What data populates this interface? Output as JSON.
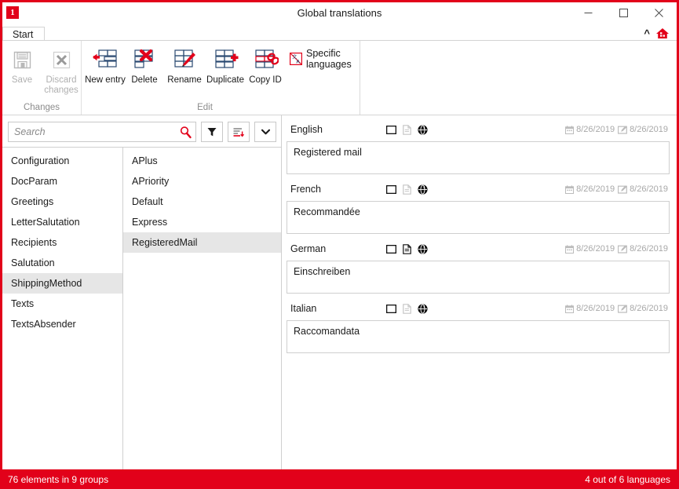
{
  "window": {
    "title": "Global translations",
    "app_icon": "1",
    "controls": {
      "minimize": "minimize-icon",
      "maximize": "maximize-icon",
      "close": "close-icon",
      "collapse_ribbon": "chevron-up-icon",
      "help": "home-icon"
    }
  },
  "ribbon": {
    "tabs": [
      {
        "label": "Start",
        "active": true
      }
    ],
    "groups": [
      {
        "label": "Changes",
        "buttons": [
          {
            "label": "Save",
            "icon": "save-icon",
            "enabled": false
          },
          {
            "label": "Discard changes",
            "icon": "discard-icon",
            "enabled": false
          }
        ]
      },
      {
        "label": "Edit",
        "buttons": [
          {
            "label": "New entry",
            "icon": "new-entry-icon",
            "enabled": true
          },
          {
            "label": "Delete",
            "icon": "delete-icon",
            "enabled": true
          },
          {
            "label": "Rename",
            "icon": "rename-icon",
            "enabled": true
          },
          {
            "label": "Duplicate",
            "icon": "duplicate-icon",
            "enabled": true
          },
          {
            "label": "Copy ID",
            "icon": "copy-id-icon",
            "enabled": true
          }
        ],
        "inline_buttons": [
          {
            "label": "Specific languages",
            "icon": "specific-languages-icon",
            "enabled": true
          }
        ]
      }
    ]
  },
  "search": {
    "value": "",
    "placeholder": "Search",
    "icon": "search-icon",
    "buttons": [
      {
        "name": "filter-button",
        "icon": "funnel-icon"
      },
      {
        "name": "sort-button",
        "icon": "sort-descending-icon"
      },
      {
        "name": "more-options-button",
        "icon": "chevron-down-icon"
      }
    ]
  },
  "groups_list": {
    "items": [
      {
        "label": "Configuration",
        "selected": false
      },
      {
        "label": "DocParam",
        "selected": false
      },
      {
        "label": "Greetings",
        "selected": false
      },
      {
        "label": "LetterSalutation",
        "selected": false
      },
      {
        "label": "Recipients",
        "selected": false
      },
      {
        "label": "Salutation",
        "selected": false
      },
      {
        "label": "ShippingMethod",
        "selected": true
      },
      {
        "label": "Texts",
        "selected": false
      },
      {
        "label": "TextsAbsender",
        "selected": false
      }
    ]
  },
  "entries_list": {
    "items": [
      {
        "label": "APlus",
        "selected": false
      },
      {
        "label": "APriority",
        "selected": false
      },
      {
        "label": "Default",
        "selected": false
      },
      {
        "label": "Express",
        "selected": false
      },
      {
        "label": "RegisteredMail",
        "selected": true
      }
    ]
  },
  "translations": [
    {
      "language": "English",
      "text": "Registered mail",
      "icons": [
        {
          "name": "screen-icon",
          "active": true
        },
        {
          "name": "document-icon",
          "active": false
        },
        {
          "name": "globe-icon",
          "active": true
        }
      ],
      "created": "8/26/2019",
      "modified": "8/26/2019"
    },
    {
      "language": "French",
      "text": "Recommandée",
      "icons": [
        {
          "name": "screen-icon",
          "active": true
        },
        {
          "name": "document-icon",
          "active": false
        },
        {
          "name": "globe-icon",
          "active": true
        }
      ],
      "created": "8/26/2019",
      "modified": "8/26/2019"
    },
    {
      "language": "German",
      "text": "Einschreiben",
      "icons": [
        {
          "name": "screen-icon",
          "active": true
        },
        {
          "name": "document-icon",
          "active": true
        },
        {
          "name": "globe-icon",
          "active": true
        }
      ],
      "created": "8/26/2019",
      "modified": "8/26/2019"
    },
    {
      "language": "Italian",
      "text": "Raccomandata",
      "icons": [
        {
          "name": "screen-icon",
          "active": true
        },
        {
          "name": "document-icon",
          "active": false
        },
        {
          "name": "globe-icon",
          "active": true
        }
      ],
      "created": "8/26/2019",
      "modified": "8/26/2019"
    }
  ],
  "statusbar": {
    "left": "76 elements in 9 groups",
    "right": "4 out of 6 languages"
  },
  "colors": {
    "accent": "#e2011a",
    "selection": "#e6e6e6",
    "border": "#cfcfcf",
    "muted_text": "#a8a8a8"
  }
}
